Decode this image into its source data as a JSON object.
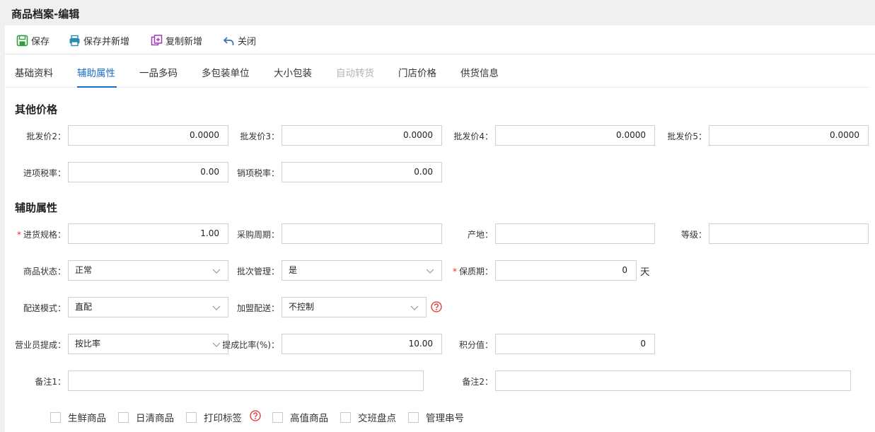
{
  "window": {
    "title": "商品档案-编辑"
  },
  "toolbar": {
    "save": "保存",
    "save_new": "保存并新增",
    "copy_new": "复制新增",
    "close": "关闭"
  },
  "tabs": [
    {
      "label": "基础资料",
      "state": "normal"
    },
    {
      "label": "辅助属性",
      "state": "active"
    },
    {
      "label": "一品多码",
      "state": "normal"
    },
    {
      "label": "多包装单位",
      "state": "normal"
    },
    {
      "label": "大小包装",
      "state": "normal"
    },
    {
      "label": "自动转货",
      "state": "disabled"
    },
    {
      "label": "门店价格",
      "state": "normal"
    },
    {
      "label": "供货信息",
      "state": "normal"
    }
  ],
  "other_prices": {
    "heading": "其他价格",
    "price2": {
      "label": "批发价2：",
      "value": "0.0000"
    },
    "price3": {
      "label": "批发价3：",
      "value": "0.0000"
    },
    "price4": {
      "label": "批发价4：",
      "value": "0.0000"
    },
    "price5": {
      "label": "批发价5：",
      "value": "0.0000"
    },
    "input_tax": {
      "label": "进项税率：",
      "value": "0.00"
    },
    "output_tax": {
      "label": "销项税率：",
      "value": "0.00"
    }
  },
  "aux": {
    "heading": "辅助属性",
    "purchase_spec": {
      "label": "进货规格：",
      "value": "1.00",
      "required": "*"
    },
    "purchase_cycle": {
      "label": "采购周期：",
      "value": ""
    },
    "origin": {
      "label": "产地：",
      "value": ""
    },
    "grade": {
      "label": "等级：",
      "value": ""
    },
    "status": {
      "label": "商品状态：",
      "value": "正常"
    },
    "batch": {
      "label": "批次管理：",
      "value": "是"
    },
    "shelf_life": {
      "label": "保质期：",
      "value": "0",
      "unit": "天",
      "required": "*"
    },
    "delivery_mode": {
      "label": "配送模式：",
      "value": "直配"
    },
    "franchise": {
      "label": "加盟配送：",
      "value": "不控制"
    },
    "commission": {
      "label": "营业员提成：",
      "value": "按比率"
    },
    "commission_rate": {
      "label": "提成比率(%)：",
      "value": "10.00"
    },
    "points": {
      "label": "积分值：",
      "value": "0"
    },
    "note1": {
      "label": "备注1：",
      "value": ""
    },
    "note2": {
      "label": "备注2：",
      "value": ""
    }
  },
  "checkboxes": [
    {
      "label": "生鲜商品",
      "checked": false
    },
    {
      "label": "日清商品",
      "checked": false
    },
    {
      "label": "打印标签",
      "checked": false
    },
    {
      "label": "高值商品",
      "checked": false
    },
    {
      "label": "交班盘点",
      "checked": false
    },
    {
      "label": "管理串号",
      "checked": false
    }
  ],
  "colors": {
    "accent": "#1a6fc9",
    "required": "#e0332b",
    "help": "#e0332b",
    "disabled_tab": "#b3b3b3"
  }
}
